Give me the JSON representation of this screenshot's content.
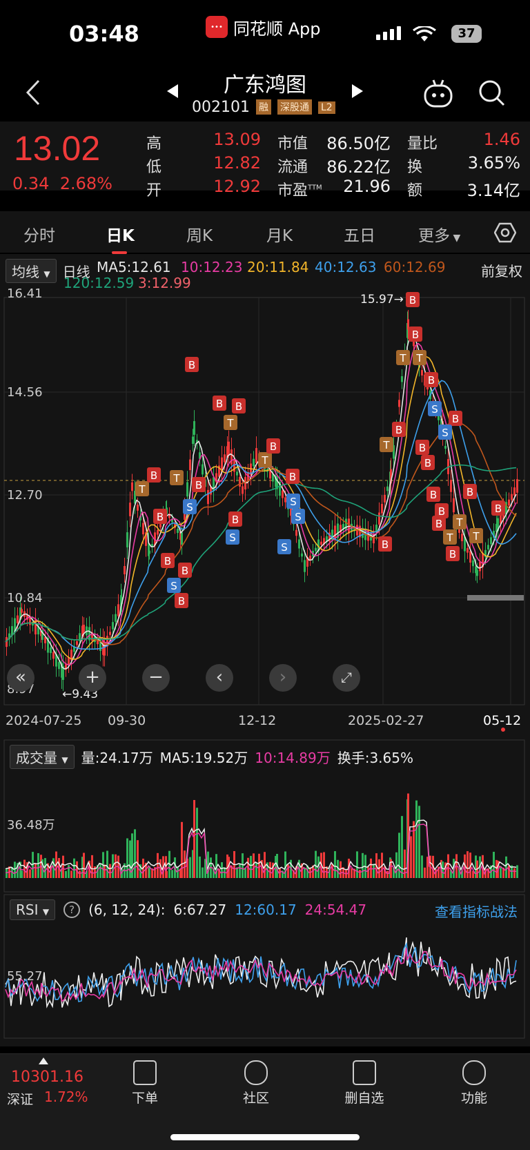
{
  "status": {
    "time": "03:48",
    "app": "同花顺 App",
    "battery": "37"
  },
  "header": {
    "title": "广东鸿图",
    "code": "002101",
    "tags": [
      "融",
      "深股通",
      "L2"
    ]
  },
  "quote": {
    "price": "13.02",
    "change": "0.34",
    "change_pct": "2.68%",
    "fields": [
      {
        "label": "高",
        "value": "13.09",
        "color": "#f03a3a"
      },
      {
        "label": "低",
        "value": "12.82",
        "color": "#f03a3a"
      },
      {
        "label": "开",
        "value": "12.92",
        "color": "#f03a3a"
      },
      {
        "label": "市值",
        "value": "86.50亿",
        "color": "#f2f2f2"
      },
      {
        "label": "流通",
        "value": "86.22亿",
        "color": "#f2f2f2"
      },
      {
        "label": "市盈",
        "sup": "TTM",
        "value": "21.96",
        "color": "#f2f2f2"
      },
      {
        "label": "量比",
        "value": "1.46",
        "color": "#f03a3a"
      },
      {
        "label": "换",
        "value": "3.65%",
        "color": "#f2f2f2"
      },
      {
        "label": "额",
        "value": "3.14亿",
        "color": "#f2f2f2"
      }
    ]
  },
  "tabs": [
    "分时",
    "日K",
    "周K",
    "月K",
    "五日",
    "更多"
  ],
  "ma_legend": {
    "selector": "均线",
    "label": "日线",
    "items": [
      {
        "text": "MA5:12.61",
        "color": "#e6e6e6"
      },
      {
        "text": "10:12.23",
        "color": "#e83ca4"
      },
      {
        "text": "20:11.84",
        "color": "#f2b52a"
      },
      {
        "text": "40:12.63",
        "color": "#3ea0ec"
      },
      {
        "text": "60:12.69",
        "color": "#c0571c"
      },
      {
        "text": "120:12.59",
        "color": "#1fa37a"
      },
      {
        "text": "3:12.99",
        "color": "#f0616a"
      }
    ],
    "adjust": "前复权"
  },
  "price_axis": [
    "16.41",
    "14.56",
    "12.70",
    "10.84",
    "8.97"
  ],
  "high_mark": "15.97",
  "low_mark": "9.43",
  "date_axis": [
    "2024-07-25",
    "09-30",
    "12-12",
    "2025-02-27",
    "05-12"
  ],
  "volume": {
    "selector": "成交量",
    "vol": "量:24.17万",
    "ma5": "MA5:19.52万",
    "ma10": "10:14.89万",
    "turnover": "换手:3.65%",
    "axis": "36.48万"
  },
  "rsi": {
    "selector": "RSI",
    "params": "(6, 12, 24):",
    "r6": "6:67.27",
    "r12": "12:60.17",
    "r24": "24:54.47",
    "link": "查看指标战法",
    "axis": "55.27"
  },
  "bottom": {
    "index_value": "10301.16",
    "index_name": "深证",
    "index_pct": "1.72%",
    "items": [
      "下单",
      "社区",
      "删自选",
      "功能"
    ]
  },
  "colors": {
    "up": "#f03a3a",
    "down": "#2fb35a",
    "bg": "#141414"
  }
}
